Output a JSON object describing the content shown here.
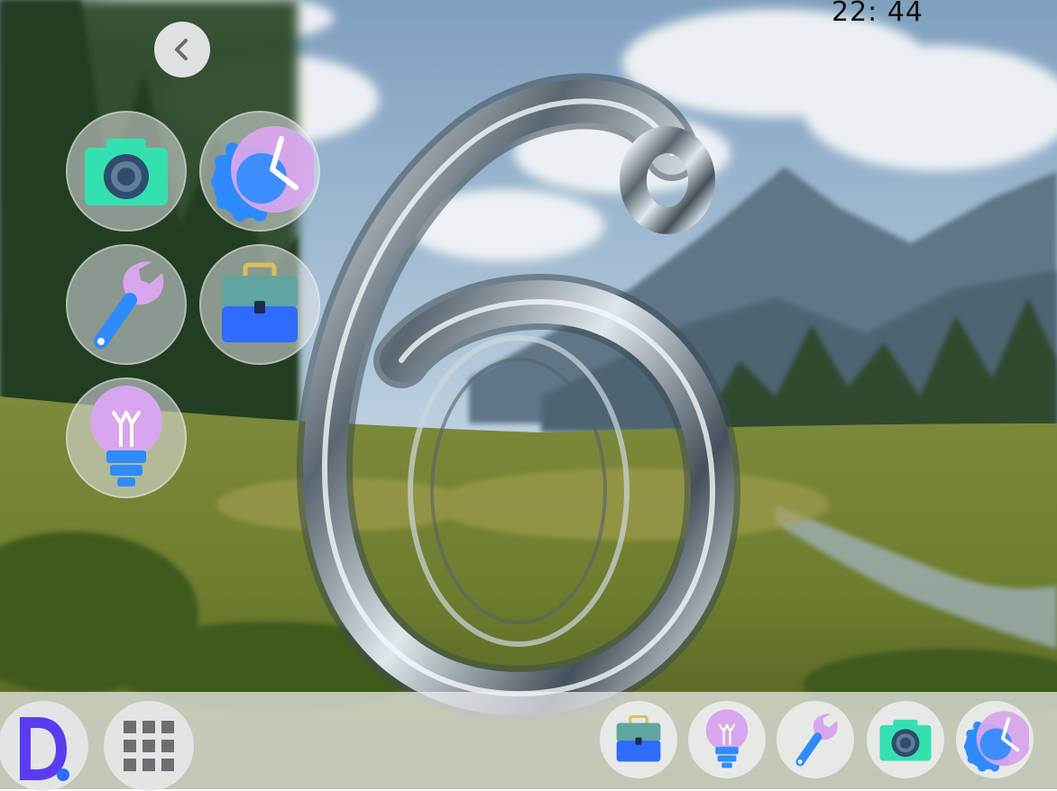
{
  "status_bar": {
    "time": "22: 44"
  },
  "wallpaper": {
    "digit": "6"
  },
  "colors": {
    "camera_body": "#35E0B0",
    "lens": "#2E4D6E",
    "accent_blue": "#2E8BFF",
    "lilac": "#D7A6EC",
    "dock_logo": "#5A3CF0"
  },
  "launcher": {
    "back_icon": "chevron-left-icon",
    "apps": [
      {
        "icon": "camera-icon"
      },
      {
        "icon": "clock-icon"
      },
      {
        "icon": "wrench-icon"
      },
      {
        "icon": "toolbox-icon"
      },
      {
        "icon": "lightbulb-icon"
      }
    ]
  },
  "dock": {
    "logo_letter": "D",
    "grid_icon": "app-grid-icon",
    "apps": [
      {
        "icon": "toolbox-icon"
      },
      {
        "icon": "lightbulb-icon"
      },
      {
        "icon": "wrench-icon"
      },
      {
        "icon": "camera-icon"
      },
      {
        "icon": "clock-icon"
      }
    ]
  }
}
